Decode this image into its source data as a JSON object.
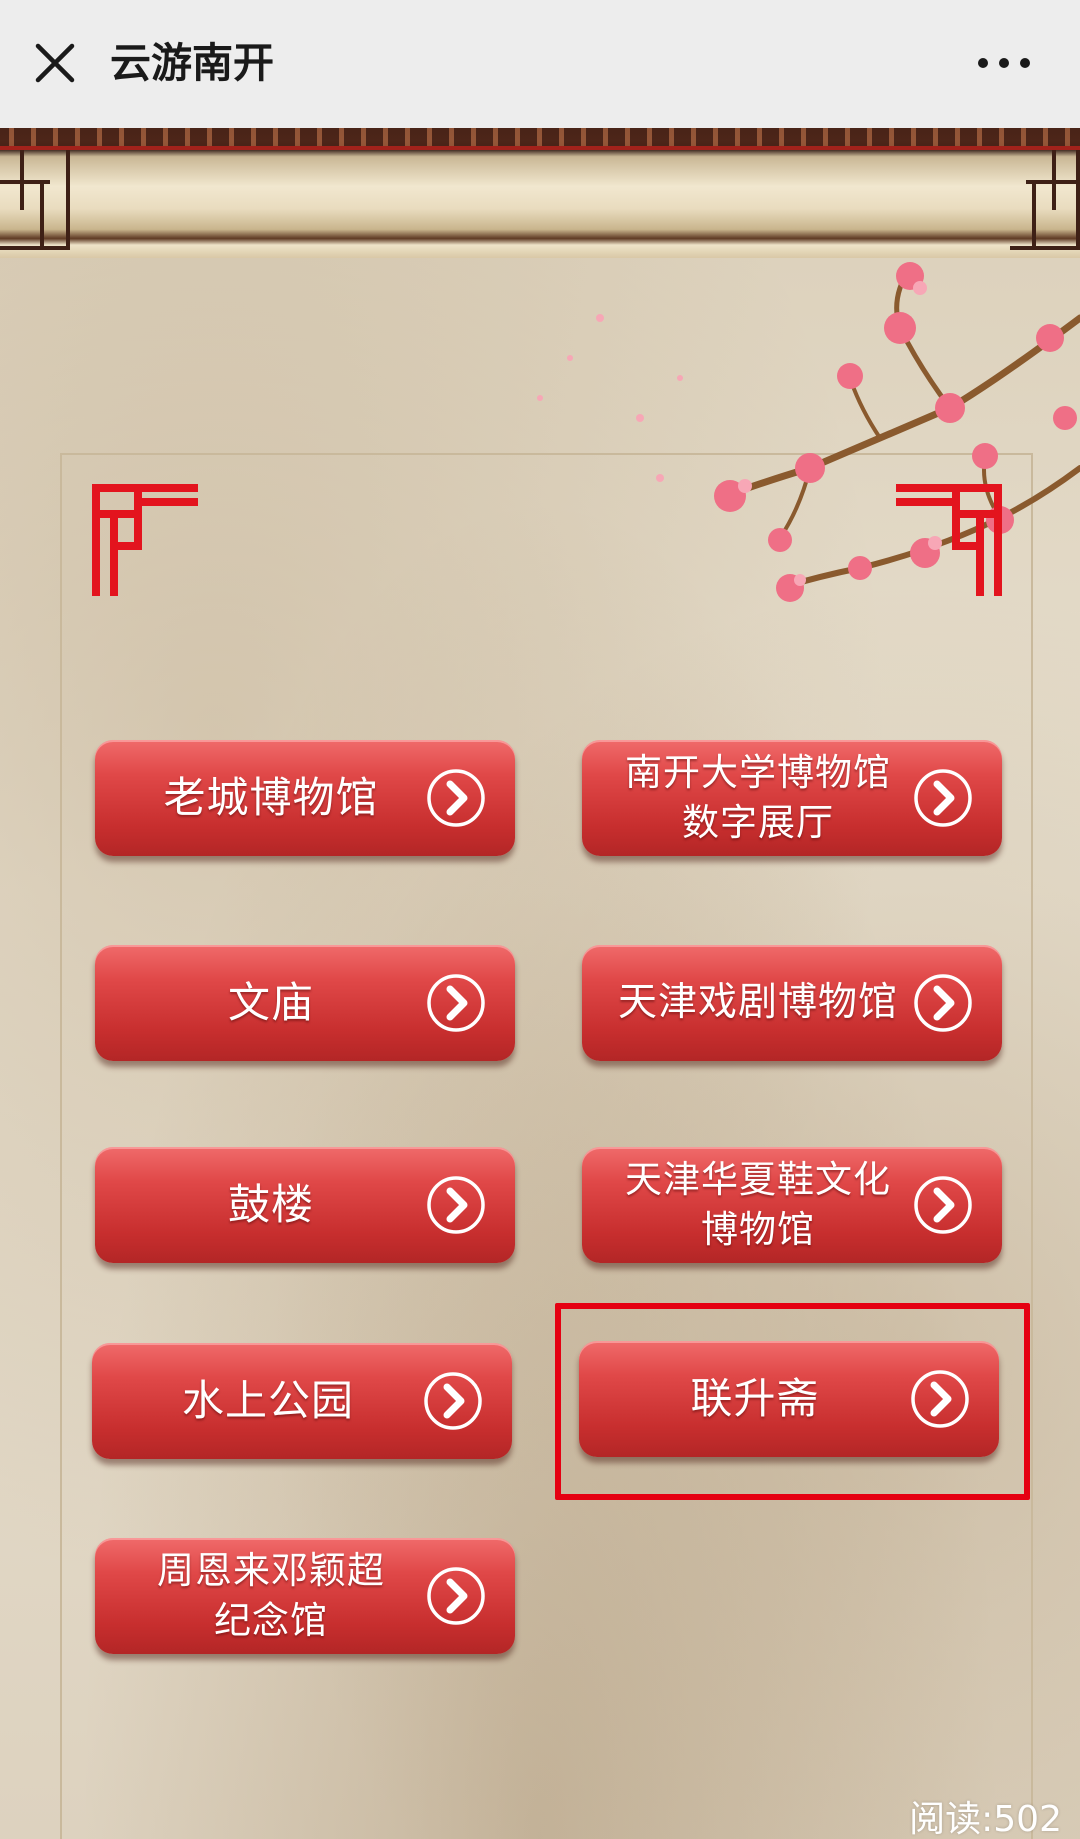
{
  "header": {
    "title": "云游南开",
    "close_icon": "close-icon",
    "more_icon": "more-icon"
  },
  "buttons": [
    {
      "label": "老城博物馆",
      "icon": "chevron-right-icon"
    },
    {
      "label": "南开大学博物馆数字展厅",
      "line1": "南开大学博物馆",
      "line2": "数字展厅",
      "icon": "chevron-right-icon"
    },
    {
      "label": "文庙",
      "icon": "chevron-right-icon"
    },
    {
      "label": "天津戏剧博物馆",
      "icon": "chevron-right-icon"
    },
    {
      "label": "鼓楼",
      "icon": "chevron-right-icon"
    },
    {
      "label": "天津华夏鞋文化博物馆",
      "line1": "天津华夏鞋文化",
      "line2": "博物馆",
      "icon": "chevron-right-icon"
    },
    {
      "label": "水上公园",
      "icon": "chevron-right-icon"
    },
    {
      "label": "联升斋",
      "icon": "chevron-right-icon",
      "highlighted": true
    },
    {
      "label": "周恩来邓颖超纪念馆",
      "line1": "周恩来邓颖超",
      "line2": "纪念馆",
      "icon": "chevron-right-icon"
    }
  ],
  "footer": {
    "read_label": "阅读:",
    "read_count": "502"
  },
  "colors": {
    "button_red": "#d63a3a",
    "highlight_red": "#e50012",
    "frame_red": "#e3141e",
    "navbar_bg": "#ededed"
  }
}
